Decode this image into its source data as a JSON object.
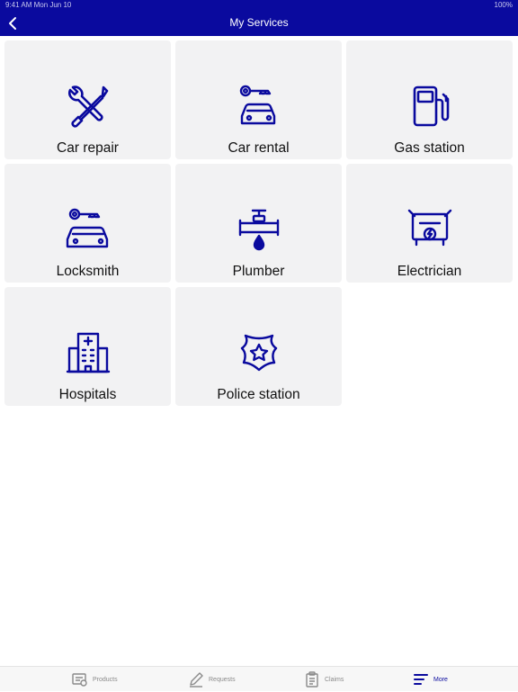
{
  "status_bar": {
    "left": "9:41 AM  Mon Jun 10",
    "right": "100%"
  },
  "header": {
    "title": "My Services",
    "back_icon": "chevron-left-icon"
  },
  "services": [
    {
      "label": "Car repair",
      "icon": "wrench-screwdriver-icon"
    },
    {
      "label": "Car rental",
      "icon": "car-key-icon"
    },
    {
      "label": "Gas station",
      "icon": "fuel-pump-icon"
    },
    {
      "label": "Locksmith",
      "icon": "key-car-icon"
    },
    {
      "label": "Plumber",
      "icon": "faucet-icon"
    },
    {
      "label": "Electrician",
      "icon": "electric-panel-icon"
    },
    {
      "label": "Hospitals",
      "icon": "hospital-icon"
    },
    {
      "label": "Police station",
      "icon": "police-badge-icon"
    }
  ],
  "tabs": [
    {
      "label": "Products",
      "icon": "products-icon",
      "active": false
    },
    {
      "label": "Requests",
      "icon": "pencil-icon",
      "active": false
    },
    {
      "label": "Claims",
      "icon": "clipboard-icon",
      "active": false
    },
    {
      "label": "More",
      "icon": "menu-lines-icon",
      "active": true
    }
  ],
  "colors": {
    "brand": "#0a0a9e",
    "tile_bg": "#f2f2f3",
    "icon": "#0a0a9e"
  }
}
